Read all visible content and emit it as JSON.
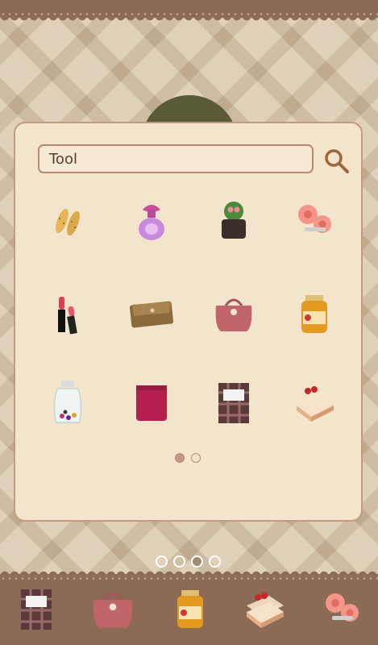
{
  "search": {
    "query": "Tool"
  },
  "icons": {
    "row1": [
      "flats-shoes-icon",
      "perfume-bottle-icon",
      "potted-cactus-icon",
      "pink-flower-hairclips-icon"
    ],
    "row2": [
      "lipstick-icon",
      "brown-wallet-icon",
      "pink-handbag-icon",
      "honey-jar-icon"
    ],
    "row3": [
      "candy-jar-icon",
      "red-sweater-icon",
      "plaid-notebook-icon",
      "strawberry-cake-icon"
    ]
  },
  "pager": {
    "pages": 2,
    "current": 1
  },
  "home_pager": {
    "pages": 4,
    "current": 3
  },
  "dock": {
    "items": [
      "plaid-notebook-icon",
      "pink-handbag-icon",
      "honey-jar-icon",
      "strawberry-cake-icon",
      "pink-flower-hairclips-icon"
    ]
  }
}
